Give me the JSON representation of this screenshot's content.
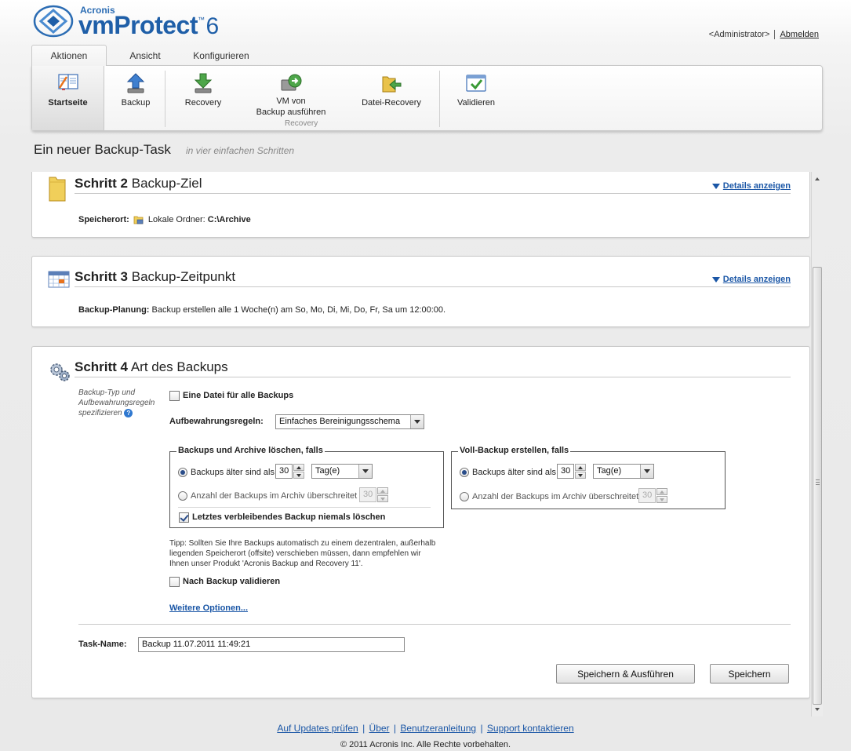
{
  "brand": {
    "company": "Acronis",
    "product": "vmProtect",
    "tm": "™",
    "version": "6"
  },
  "user": {
    "name": "<Administrator>",
    "logout": "Abmelden"
  },
  "tabs": [
    {
      "label": "Aktionen"
    },
    {
      "label": "Ansicht"
    },
    {
      "label": "Konfigurieren"
    }
  ],
  "ribbon": {
    "home": "Startseite",
    "backup": "Backup",
    "recovery": "Recovery",
    "run_vm_line1": "VM von",
    "run_vm_line2": "Backup ausführen",
    "file_recovery": "Datei-Recovery",
    "validate": "Validieren",
    "group_recovery": "Recovery"
  },
  "page": {
    "title": "Ein neuer Backup-Task",
    "subtitle": "in vier einfachen Schritten"
  },
  "step2": {
    "num": "Schritt 2",
    "name": "Backup-Ziel",
    "details": "Details anzeigen",
    "location_label": "Speicherort:",
    "location_type": "Lokale Ordner:",
    "location_path": "C:\\Archive"
  },
  "step3": {
    "num": "Schritt 3",
    "name": "Backup-Zeitpunkt",
    "details": "Details anzeigen",
    "schedule_label": "Backup-Planung:",
    "schedule_value": "Backup erstellen alle 1 Woche(n) am So, Mo, Di, Mi, Do, Fr, Sa um 12:00:00."
  },
  "step4": {
    "num": "Schritt 4",
    "name": "Art des Backups",
    "hint_line1": "Backup-Typ und",
    "hint_line2": "Aufbewahrungsregeln",
    "hint_line3": "spezifizieren",
    "help_icon": "?",
    "single_file": {
      "label": "Eine Datei für alle Backups",
      "checked": false
    },
    "retention_label": "Aufbewahrungsregeln:",
    "retention_value": "Einfaches Bereinigungsschema",
    "delete_group": {
      "title": "Backups und Archive löschen, falls",
      "older_label": "Backups älter sind als",
      "older_value": "30",
      "older_unit": "Tag(e)",
      "count_label": "Anzahl der Backups im Archiv überschreitet",
      "count_value": "30",
      "never_delete_label": "Letztes verbleibendes Backup niemals löschen",
      "never_delete_checked": true
    },
    "full_group": {
      "title": "Voll-Backup erstellen, falls",
      "older_label": "Backups älter sind als",
      "older_value": "30",
      "older_unit": "Tag(e)",
      "count_label": "Anzahl der Backups im Archiv überschreitet",
      "count_value": "30"
    },
    "tip_line1": "Tipp: Sollten Sie Ihre Backups automatisch zu einem dezentralen, außerhalb",
    "tip_line2": "liegenden Speicherort (offsite) verschieben müssen, dann empfehlen wir",
    "tip_line3": "Ihnen unser Produkt 'Acronis Backup and Recovery 11'.",
    "validate": {
      "label": "Nach Backup validieren",
      "checked": false
    },
    "more_options": "Weitere Optionen...",
    "task_name_label": "Task-Name:",
    "task_name_value": "Backup 11.07.2011 11:49:21",
    "btn_save_run": "Speichern & Ausführen",
    "btn_save": "Speichern"
  },
  "footer": {
    "updates": "Auf Updates prüfen",
    "about": "Über",
    "manual": "Benutzeranleitung",
    "support": "Support kontaktieren",
    "separator": "|",
    "copyright": "© 2011 Acronis Inc. Alle Rechte vorbehalten."
  },
  "colors": {
    "link": "#1a56a6",
    "brand": "#1f5fa8"
  },
  "icons": {
    "logo": "acronis-logo-icon",
    "home": "home-icon",
    "backup": "backup-upload-icon",
    "recovery": "recovery-download-icon",
    "run_vm": "run-vm-icon",
    "file_recovery": "file-recovery-icon",
    "validate": "validate-icon",
    "folder": "folder-icon",
    "calendar": "calendar-icon",
    "gears": "gears-icon"
  }
}
